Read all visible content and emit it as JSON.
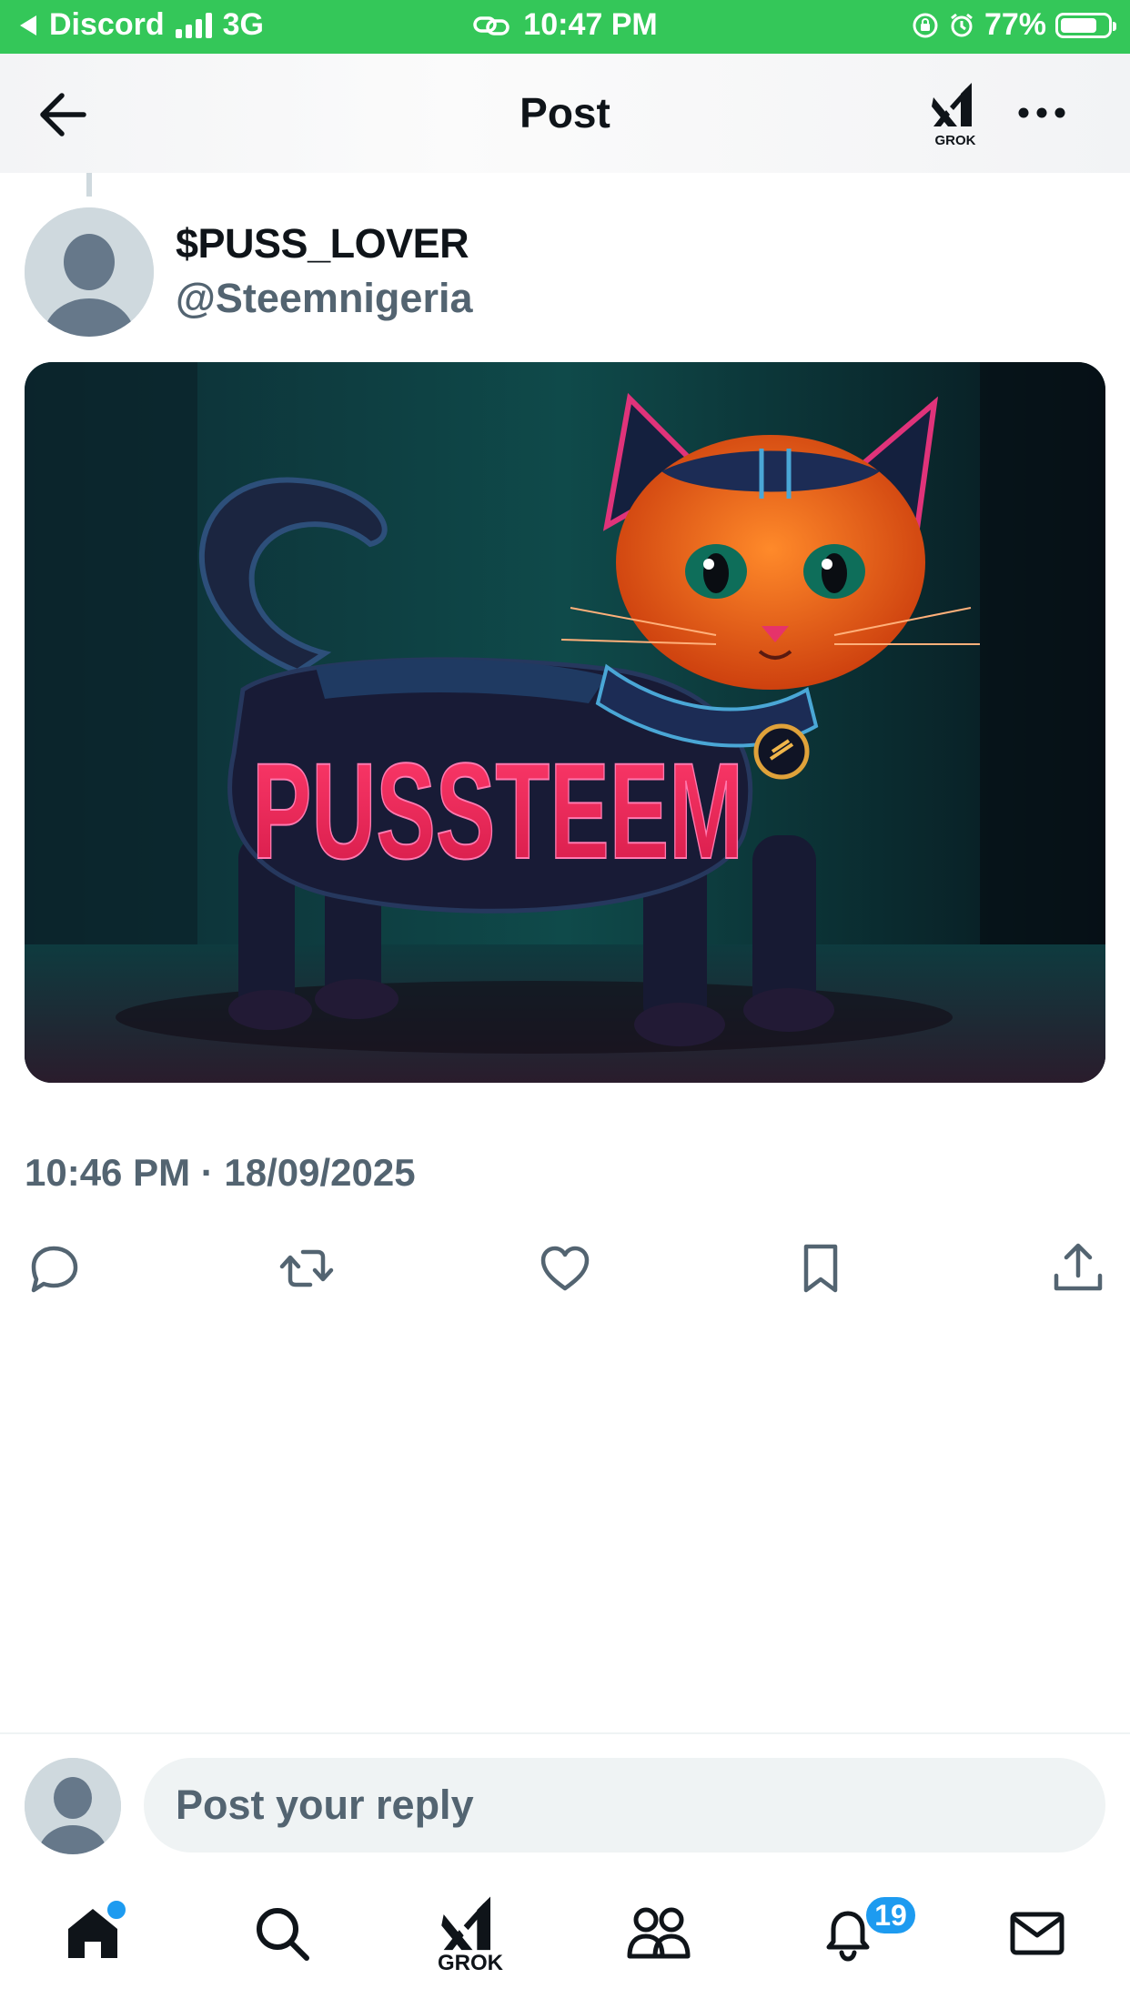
{
  "status_bar": {
    "back_app": "Discord",
    "network": "3G",
    "time": "10:47 PM",
    "battery": "77%",
    "battery_level": 0.77
  },
  "header": {
    "title": "Post",
    "grok_label": "GROK"
  },
  "post": {
    "display_name": "$PUSS_LOVER",
    "handle": "@Steemnigeria",
    "image_text": "PUSSTEEM",
    "timestamp": "10:46 PM · 18/09/2025"
  },
  "actions": [
    "reply-icon",
    "repost-icon",
    "like-icon",
    "bookmark-icon",
    "share-icon"
  ],
  "reply": {
    "placeholder": "Post your reply"
  },
  "tab_bar": {
    "grok_label": "GROK",
    "notifications_badge": "19"
  },
  "colors": {
    "status_green": "#34c759",
    "accent_blue": "#1d9bf0",
    "secondary_text": "#536471"
  }
}
